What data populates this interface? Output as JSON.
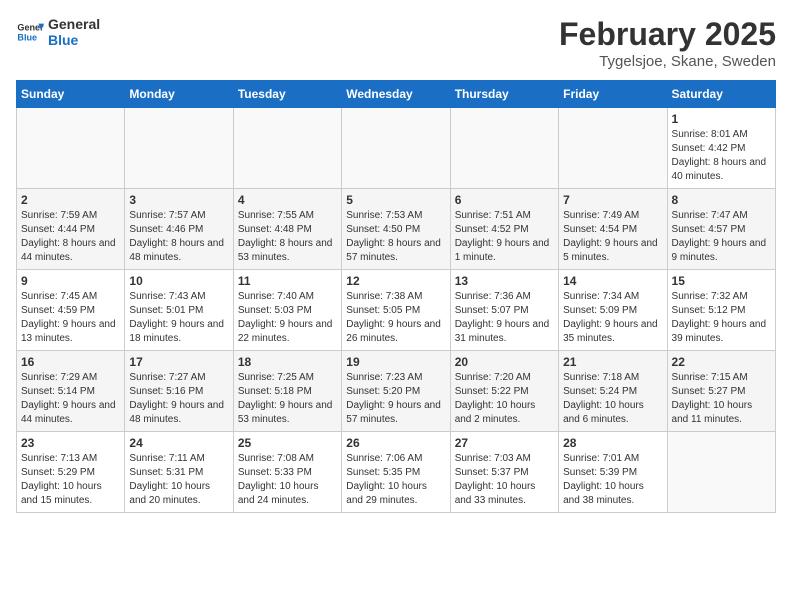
{
  "header": {
    "logo_line1": "General",
    "logo_line2": "Blue",
    "month": "February 2025",
    "location": "Tygelsjoe, Skane, Sweden"
  },
  "weekdays": [
    "Sunday",
    "Monday",
    "Tuesday",
    "Wednesday",
    "Thursday",
    "Friday",
    "Saturday"
  ],
  "weeks": [
    [
      {
        "day": "",
        "info": ""
      },
      {
        "day": "",
        "info": ""
      },
      {
        "day": "",
        "info": ""
      },
      {
        "day": "",
        "info": ""
      },
      {
        "day": "",
        "info": ""
      },
      {
        "day": "",
        "info": ""
      },
      {
        "day": "1",
        "info": "Sunrise: 8:01 AM\nSunset: 4:42 PM\nDaylight: 8 hours and 40 minutes."
      }
    ],
    [
      {
        "day": "2",
        "info": "Sunrise: 7:59 AM\nSunset: 4:44 PM\nDaylight: 8 hours and 44 minutes."
      },
      {
        "day": "3",
        "info": "Sunrise: 7:57 AM\nSunset: 4:46 PM\nDaylight: 8 hours and 48 minutes."
      },
      {
        "day": "4",
        "info": "Sunrise: 7:55 AM\nSunset: 4:48 PM\nDaylight: 8 hours and 53 minutes."
      },
      {
        "day": "5",
        "info": "Sunrise: 7:53 AM\nSunset: 4:50 PM\nDaylight: 8 hours and 57 minutes."
      },
      {
        "day": "6",
        "info": "Sunrise: 7:51 AM\nSunset: 4:52 PM\nDaylight: 9 hours and 1 minute."
      },
      {
        "day": "7",
        "info": "Sunrise: 7:49 AM\nSunset: 4:54 PM\nDaylight: 9 hours and 5 minutes."
      },
      {
        "day": "8",
        "info": "Sunrise: 7:47 AM\nSunset: 4:57 PM\nDaylight: 9 hours and 9 minutes."
      }
    ],
    [
      {
        "day": "9",
        "info": "Sunrise: 7:45 AM\nSunset: 4:59 PM\nDaylight: 9 hours and 13 minutes."
      },
      {
        "day": "10",
        "info": "Sunrise: 7:43 AM\nSunset: 5:01 PM\nDaylight: 9 hours and 18 minutes."
      },
      {
        "day": "11",
        "info": "Sunrise: 7:40 AM\nSunset: 5:03 PM\nDaylight: 9 hours and 22 minutes."
      },
      {
        "day": "12",
        "info": "Sunrise: 7:38 AM\nSunset: 5:05 PM\nDaylight: 9 hours and 26 minutes."
      },
      {
        "day": "13",
        "info": "Sunrise: 7:36 AM\nSunset: 5:07 PM\nDaylight: 9 hours and 31 minutes."
      },
      {
        "day": "14",
        "info": "Sunrise: 7:34 AM\nSunset: 5:09 PM\nDaylight: 9 hours and 35 minutes."
      },
      {
        "day": "15",
        "info": "Sunrise: 7:32 AM\nSunset: 5:12 PM\nDaylight: 9 hours and 39 minutes."
      }
    ],
    [
      {
        "day": "16",
        "info": "Sunrise: 7:29 AM\nSunset: 5:14 PM\nDaylight: 9 hours and 44 minutes."
      },
      {
        "day": "17",
        "info": "Sunrise: 7:27 AM\nSunset: 5:16 PM\nDaylight: 9 hours and 48 minutes."
      },
      {
        "day": "18",
        "info": "Sunrise: 7:25 AM\nSunset: 5:18 PM\nDaylight: 9 hours and 53 minutes."
      },
      {
        "day": "19",
        "info": "Sunrise: 7:23 AM\nSunset: 5:20 PM\nDaylight: 9 hours and 57 minutes."
      },
      {
        "day": "20",
        "info": "Sunrise: 7:20 AM\nSunset: 5:22 PM\nDaylight: 10 hours and 2 minutes."
      },
      {
        "day": "21",
        "info": "Sunrise: 7:18 AM\nSunset: 5:24 PM\nDaylight: 10 hours and 6 minutes."
      },
      {
        "day": "22",
        "info": "Sunrise: 7:15 AM\nSunset: 5:27 PM\nDaylight: 10 hours and 11 minutes."
      }
    ],
    [
      {
        "day": "23",
        "info": "Sunrise: 7:13 AM\nSunset: 5:29 PM\nDaylight: 10 hours and 15 minutes."
      },
      {
        "day": "24",
        "info": "Sunrise: 7:11 AM\nSunset: 5:31 PM\nDaylight: 10 hours and 20 minutes."
      },
      {
        "day": "25",
        "info": "Sunrise: 7:08 AM\nSunset: 5:33 PM\nDaylight: 10 hours and 24 minutes."
      },
      {
        "day": "26",
        "info": "Sunrise: 7:06 AM\nSunset: 5:35 PM\nDaylight: 10 hours and 29 minutes."
      },
      {
        "day": "27",
        "info": "Sunrise: 7:03 AM\nSunset: 5:37 PM\nDaylight: 10 hours and 33 minutes."
      },
      {
        "day": "28",
        "info": "Sunrise: 7:01 AM\nSunset: 5:39 PM\nDaylight: 10 hours and 38 minutes."
      },
      {
        "day": "",
        "info": ""
      }
    ]
  ]
}
